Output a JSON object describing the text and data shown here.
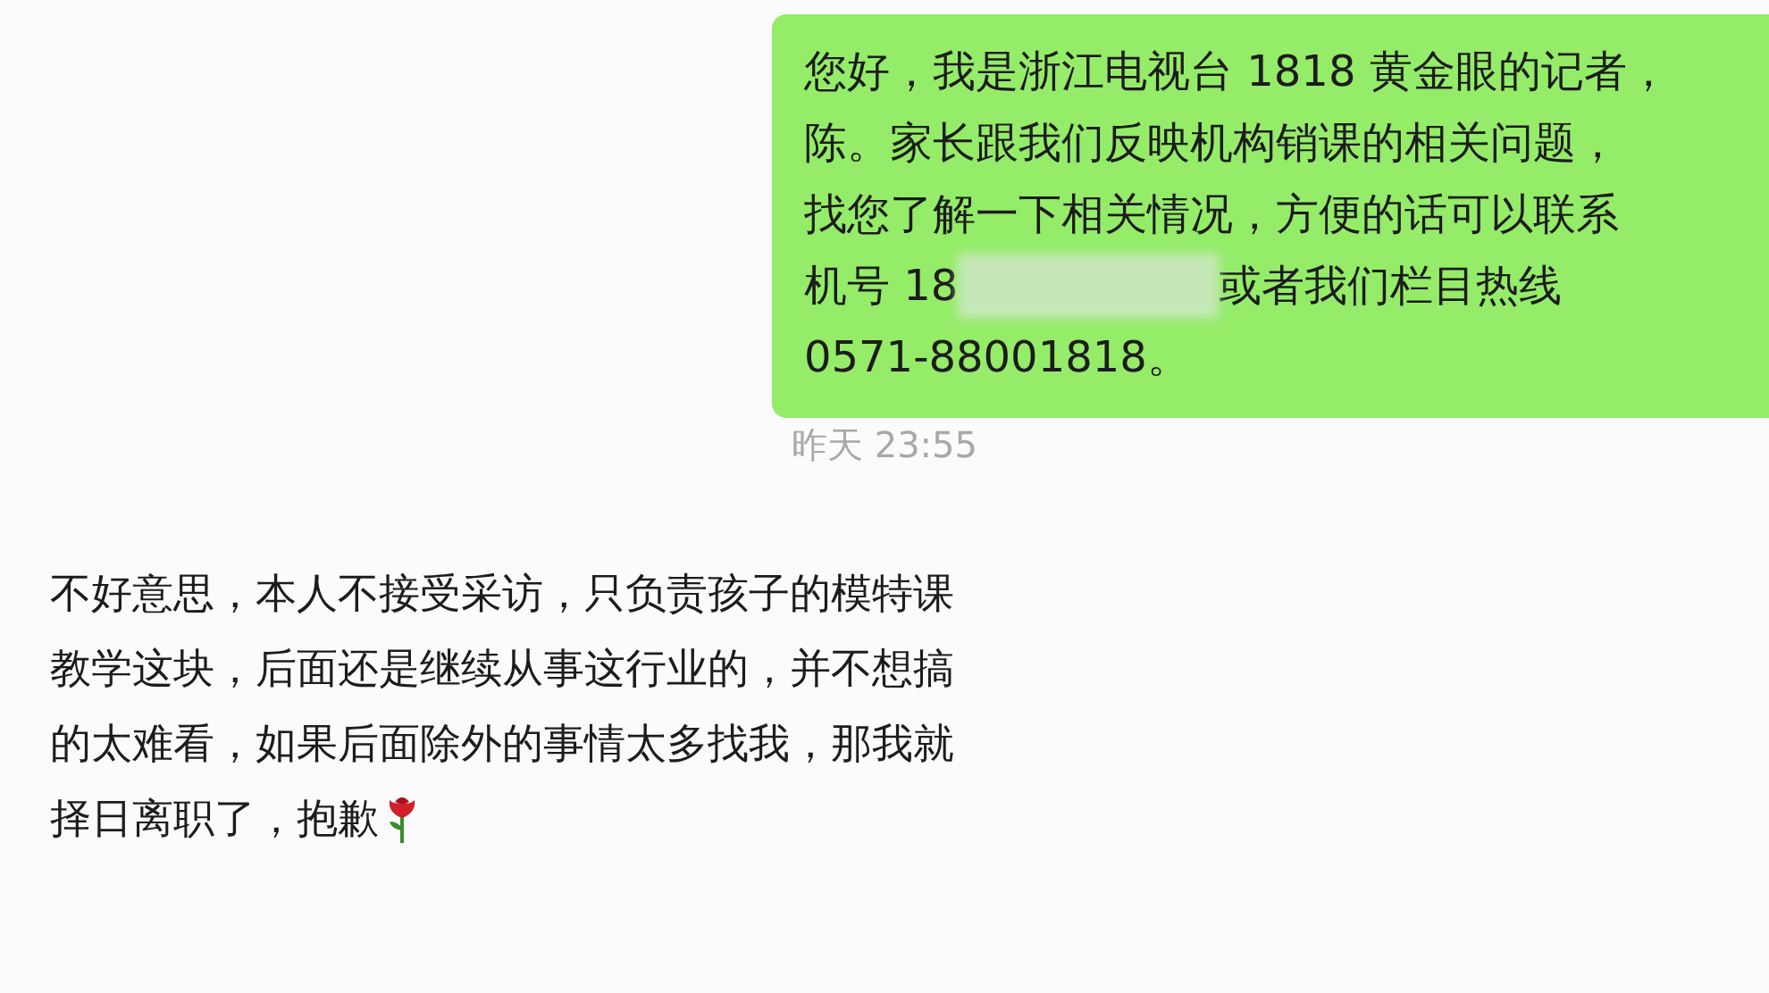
{
  "sent_message": {
    "lines": [
      {
        "parts": [
          {
            "kind": "text",
            "text": "您好，我是浙江电视台 1818 黄金眼的记者，"
          }
        ]
      },
      {
        "parts": [
          {
            "kind": "text",
            "text": "陈。家长跟我们反映机构销课的相关问题，"
          }
        ]
      },
      {
        "parts": [
          {
            "kind": "text",
            "text": "找您了解一下相关情况，方便的话可以联系"
          }
        ]
      },
      {
        "parts": [
          {
            "kind": "text",
            "text": "机号 18"
          },
          {
            "kind": "blur"
          },
          {
            "kind": "text",
            "text": "或者我们栏目热线"
          }
        ]
      },
      {
        "parts": [
          {
            "kind": "text",
            "text": "0571-88001818。"
          }
        ]
      }
    ]
  },
  "timestamp": "昨天 23:55",
  "received_message": {
    "lines": [
      "不好意思，本人不接受采访，只负责孩子的模特课",
      "教学这块，后面还是继续从事这行业的，并不想搞",
      "的太难看，如果后面除外的事情太多找我，那我就",
      "择日离职了，抱歉"
    ]
  }
}
